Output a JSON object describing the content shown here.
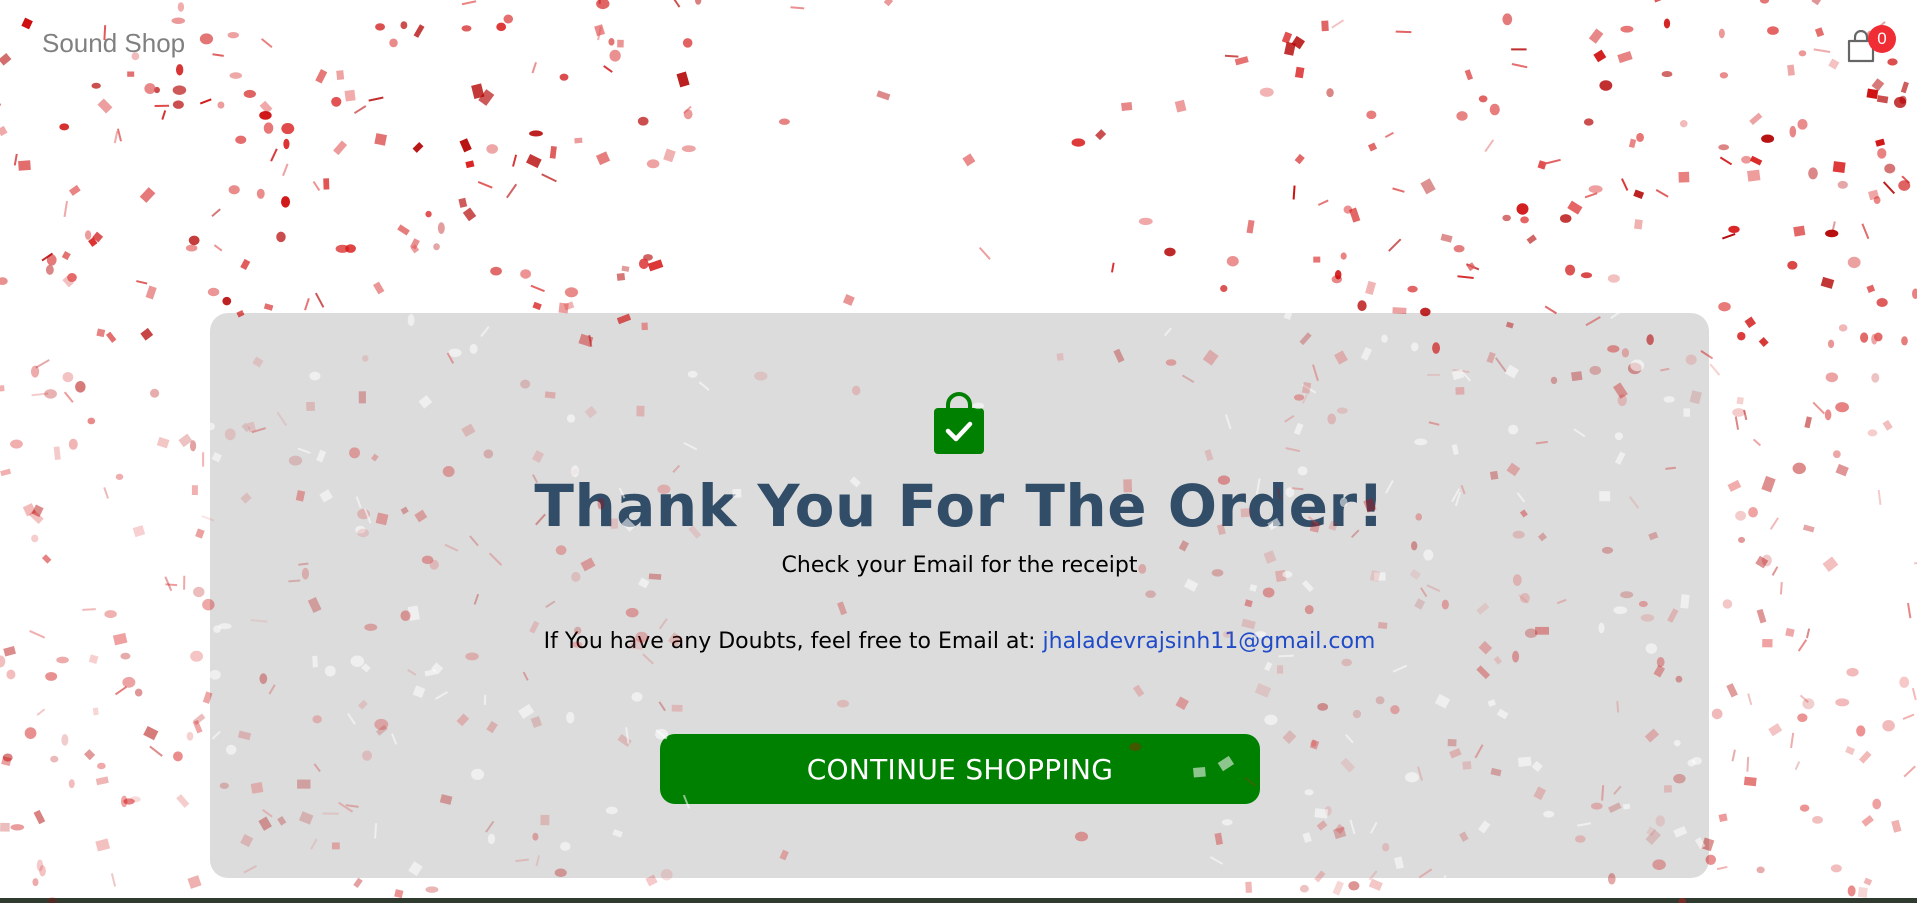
{
  "navbar": {
    "logo_text": "Sound Shop",
    "cart_icon": "shopping-bag-icon",
    "cart_count": "0"
  },
  "success": {
    "icon": "bag-check-icon",
    "title": "Thank You For The Order!",
    "email_msg": "Check your Email for the receipt",
    "description_prefix": "If You have any Doubts, feel free to Email at:",
    "email": "jhaladevrajsinh11@gmail.com",
    "button_label": "CONTINUE SHOPPING"
  },
  "colors": {
    "background": "#ffffff",
    "card": "#dcdcdc",
    "title": "#324d67",
    "button": "#008000",
    "icon": "#008000",
    "link": "#1f4bc8",
    "badge": "#f02d34",
    "confetti": "#cc0000"
  }
}
